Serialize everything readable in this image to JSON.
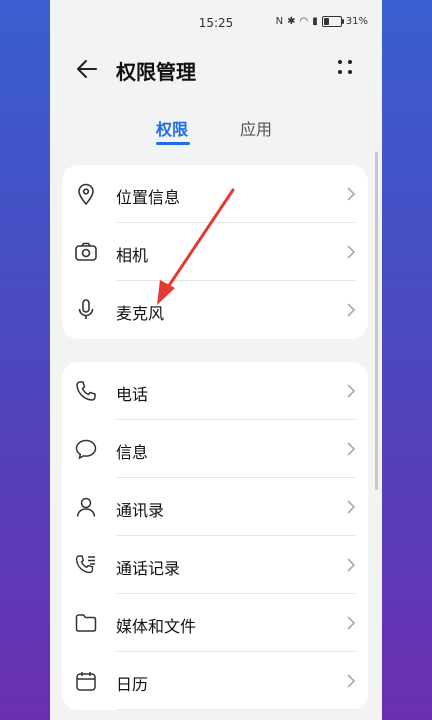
{
  "status": {
    "time": "15:25",
    "battery": "31%",
    "battery_level": 0.31
  },
  "header": {
    "title": "权限管理"
  },
  "tabs": [
    {
      "label": "权限"
    },
    {
      "label": "应用"
    }
  ],
  "groups": [
    [
      {
        "label": "位置信息",
        "icon": "location-icon"
      },
      {
        "label": "相机",
        "icon": "camera-icon"
      },
      {
        "label": "麦克风",
        "icon": "microphone-icon"
      }
    ],
    [
      {
        "label": "电话",
        "icon": "phone-icon"
      },
      {
        "label": "信息",
        "icon": "message-icon"
      },
      {
        "label": "通讯录",
        "icon": "contacts-icon"
      },
      {
        "label": "通话记录",
        "icon": "call-log-icon"
      },
      {
        "label": "媒体和文件",
        "icon": "folder-icon"
      },
      {
        "label": "日历",
        "icon": "calendar-icon"
      }
    ]
  ],
  "annotation": {
    "color": "#e53935"
  }
}
